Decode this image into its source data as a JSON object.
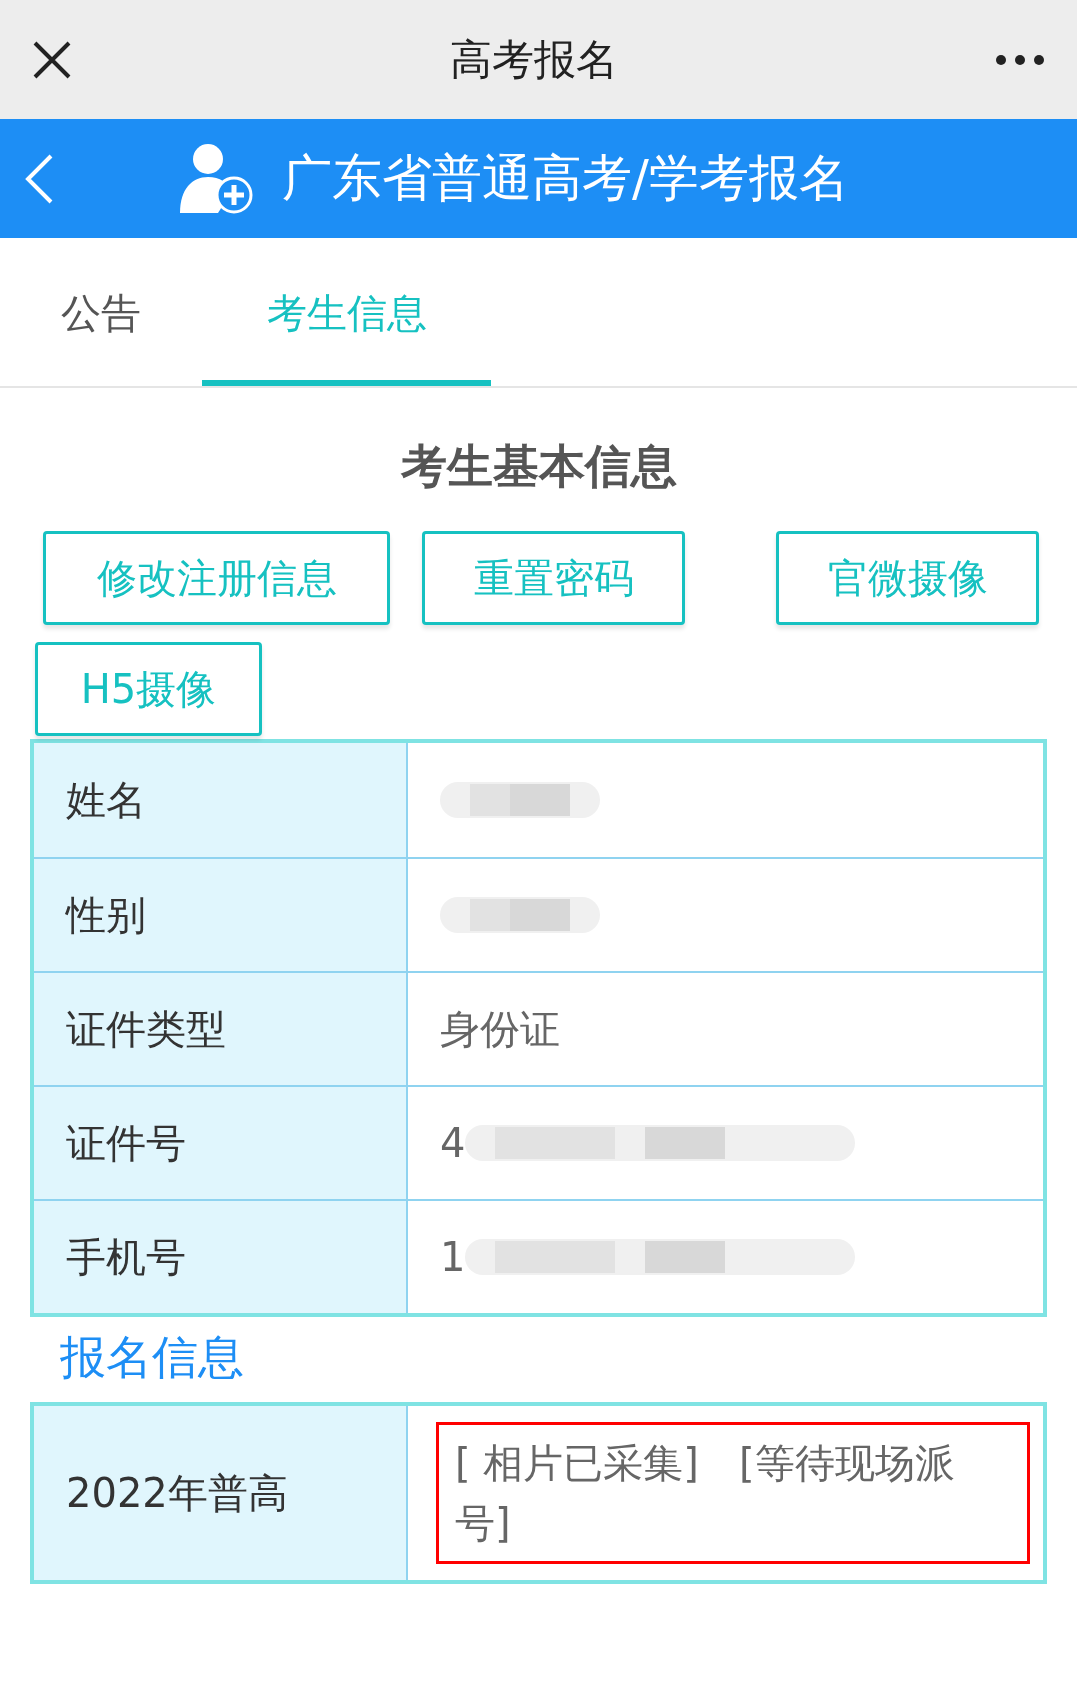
{
  "top_bar": {
    "title": "高考报名"
  },
  "header": {
    "title": "广东省普通高考/学考报名"
  },
  "tabs": [
    {
      "label": "公告",
      "selected": false
    },
    {
      "label": "考生信息",
      "selected": true
    }
  ],
  "section_title": "考生基本信息",
  "buttons": [
    {
      "label": "修改注册信息"
    },
    {
      "label": "重置密码"
    },
    {
      "label": "官微摄像"
    },
    {
      "label": "H5摄像"
    }
  ],
  "info_table": [
    {
      "label": "姓名",
      "redacted": true
    },
    {
      "label": "性别",
      "redacted": true
    },
    {
      "label": "证件类型",
      "value": "身份证",
      "redacted": false
    },
    {
      "label": "证件号",
      "value": "4",
      "redacted": true
    },
    {
      "label": "手机号",
      "value": "1",
      "redacted": true
    }
  ],
  "registration_title": "报名信息",
  "registration_table": [
    {
      "label": "2022年普高",
      "value": "[ 相片已采集]　[等待现场派号]",
      "highlighted": true
    }
  ]
}
